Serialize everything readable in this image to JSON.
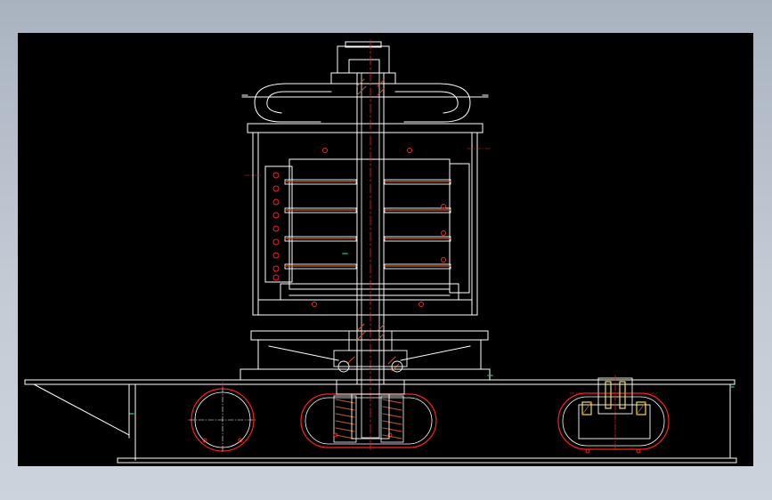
{
  "app": {
    "view_title": "",
    "background_color": "#000000",
    "frame_color": "#b8c0cb"
  },
  "drawing": {
    "subject": "",
    "palette": {
      "outline": "#ffffff",
      "section": "#c85a2a",
      "center": "#ff2020",
      "hatch": "#ff6a2a",
      "accent_green": "#20d080",
      "accent_yellow": "#f0e040"
    }
  }
}
